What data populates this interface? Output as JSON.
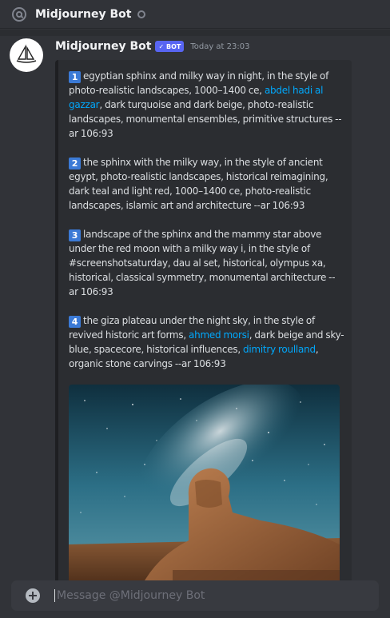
{
  "header": {
    "title": "Midjourney Bot"
  },
  "message": {
    "author": "Midjourney Bot",
    "bot_tag": "✓ BOT",
    "timestamp": "Today at 23:03"
  },
  "prompts": [
    {
      "num": "1",
      "segments": [
        {
          "text": "egyptian sphinx and milky way in night, in the style of photo-realistic landscapes, 1000–1400 ce, "
        },
        {
          "text": "abdel hadi al gazzar",
          "link": true
        },
        {
          "text": ", dark turquoise and dark beige, photo-realistic landscapes, monumental ensembles, primitive structures --ar 106:93"
        }
      ]
    },
    {
      "num": "2",
      "segments": [
        {
          "text": "the sphinx with the milky way, in the style of ancient egypt, photo-realistic landscapes, historical reimagining, dark teal and light red, 1000–1400 ce, photo-realistic landscapes, islamic art and architecture --ar 106:93"
        }
      ]
    },
    {
      "num": "3",
      "segments": [
        {
          "text": "landscape of the sphinx and the mammy star above under the red moon with a milky way i, in the style of #screenshotsaturday, dau al set, historical, olympus xa, historical, classical symmetry, monumental architecture --ar 106:93"
        }
      ]
    },
    {
      "num": "4",
      "segments": [
        {
          "text": "the giza plateau under the night sky, in the style of revived historic art forms, "
        },
        {
          "text": "ahmed morsi",
          "link": true
        },
        {
          "text": ", dark beige and sky-blue, spacecore, historical influences, "
        },
        {
          "text": "dimitry roulland",
          "link": true
        },
        {
          "text": ", organic stone carvings --ar 106:93"
        }
      ]
    }
  ],
  "composer": {
    "placeholder": "Message @Midjourney Bot"
  },
  "colors": {
    "background": "#313338",
    "embed": "#2b2d31",
    "link": "#00a8fc",
    "number_badge": "#3b7ad6",
    "bot_tag": "#5865f2"
  },
  "icons": {
    "header": "at-sign-icon",
    "status": "offline-status-icon",
    "avatar": "midjourney-sailboat-icon",
    "composer": "plus-circle-icon"
  }
}
